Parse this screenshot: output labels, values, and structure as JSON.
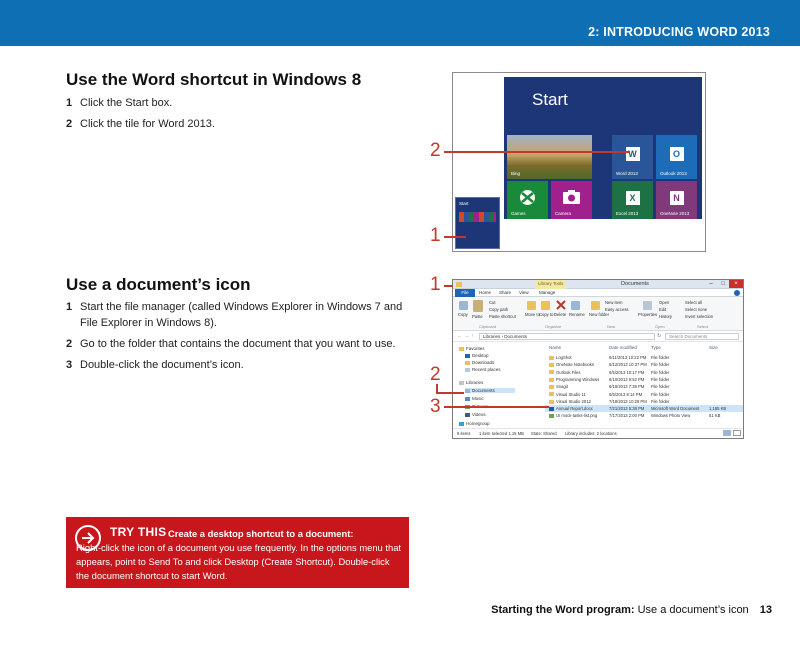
{
  "header": {
    "chapter": "2: INTRODUCING WORD 2013",
    "color": "#0e6fb5"
  },
  "section1": {
    "heading": "Use the Word shortcut in Windows 8",
    "steps": [
      {
        "num": "1",
        "text": "Click the Start box."
      },
      {
        "num": "2",
        "text": "Click the tile for Word 2013."
      }
    ]
  },
  "figure1": {
    "start_title": "Start",
    "callouts": [
      "2",
      "1"
    ],
    "tiles": [
      {
        "label": "Word 2013",
        "glyph": "W",
        "color": "#2a5699"
      },
      {
        "label": "Outlook 2013",
        "glyph": "O",
        "color": "#1e6bb8"
      },
      {
        "label": "Games",
        "glyph": "",
        "color": "#188a3a"
      },
      {
        "label": "Camera",
        "glyph": "",
        "color": "#a0208c"
      },
      {
        "label": "Excel 2013",
        "glyph": "X",
        "color": "#1e7145"
      },
      {
        "label": "OneNote 2013",
        "glyph": "N",
        "color": "#80397b"
      }
    ],
    "photo_tile_label": "Bing",
    "thumb_label": "Start"
  },
  "section2": {
    "heading": "Use a document’s icon",
    "steps": [
      {
        "num": "1",
        "text": "Start the file manager (called Windows Explorer in Windows 7 and File Explorer in Windows 8)."
      },
      {
        "num": "2",
        "text": "Go to the folder that contains the document that you want to use."
      },
      {
        "num": "3",
        "text": "Double-click the document’s icon."
      }
    ]
  },
  "figure2": {
    "callouts": [
      "1",
      "2",
      "3"
    ],
    "window_title": "Documents",
    "library_tools": "Library Tools",
    "tabs": {
      "file": "File",
      "home": "Home",
      "share": "Share",
      "view": "View",
      "manage": "Manage"
    },
    "ribbon": {
      "copy": "Copy",
      "paste": "Paste",
      "cut": "Cut",
      "copy_path": "Copy path",
      "paste_shortcut": "Paste shortcut",
      "move_to": "Move to",
      "copy_to": "Copy to",
      "delete": "Delete",
      "rename": "Rename",
      "new_folder": "New folder",
      "new_item": "New item",
      "easy_access": "Easy access",
      "properties": "Properties",
      "open": "Open",
      "edit": "Edit",
      "history": "History",
      "select_all": "Select all",
      "select_none": "Select none",
      "invert": "Invert selection",
      "groups": {
        "clipboard": "Clipboard",
        "organize": "Organize",
        "new": "New",
        "open": "Open",
        "select": "Select"
      }
    },
    "address": "Libraries  ›  Documents",
    "search_placeholder": "Search Documents",
    "nav": [
      {
        "label": "Favorites"
      },
      {
        "label": "Desktop"
      },
      {
        "label": "Downloads"
      },
      {
        "label": "Recent places"
      },
      {
        "label": "Libraries"
      },
      {
        "label": "Documents"
      },
      {
        "label": "Music"
      },
      {
        "label": "Pictures"
      },
      {
        "label": "Videos"
      },
      {
        "label": "Homegroup"
      }
    ],
    "columns": {
      "name": "Name",
      "date": "Date modified",
      "type": "Type",
      "size": "Size"
    },
    "rows": [
      {
        "name": "LogShot",
        "date": "6/11/2013 10:22 PM",
        "type": "File folder",
        "size": ""
      },
      {
        "name": "OneNote Notebooks",
        "date": "6/12/2013 10:37 PM",
        "type": "File folder",
        "size": ""
      },
      {
        "name": "Outlook Files",
        "date": "6/5/2013 10:17 PM",
        "type": "File folder",
        "size": ""
      },
      {
        "name": "Programming Windows",
        "date": "6/10/2013 9:52 PM",
        "type": "File folder",
        "size": ""
      },
      {
        "name": "Snagit",
        "date": "6/18/2013 7:36 PM",
        "type": "File folder",
        "size": ""
      },
      {
        "name": "Visual Studio 11",
        "date": "6/5/2013 8:14 PM",
        "type": "File folder",
        "size": ""
      },
      {
        "name": "Visual Studio 2012",
        "date": "7/18/2013 10:28 PM",
        "type": "File folder",
        "size": ""
      },
      {
        "name": "Annual Report.docx",
        "date": "7/21/2013 5:38 PM",
        "type": "Microsoft Word Document",
        "size": "1,185 KB"
      },
      {
        "name": "UI mock-tasks-list.png",
        "date": "7/17/2013 2:00 PM",
        "type": "Windows Photo View",
        "size": "51 KB"
      }
    ],
    "status": {
      "count": "9 items",
      "selected": "1 item selected  1.15 MB",
      "state": "State: Shared",
      "libs": "Library includes: 2 locations"
    }
  },
  "try_this": {
    "label": "TRY THIS",
    "lead": "Create a desktop shortcut to a document:",
    "body": "Right-click the icon of a document you use frequently. In the options menu that appears, point to Send To and click Desktop (Create Shortcut). Double-click the document shortcut to start Word.",
    "color": "#c8161d"
  },
  "footer": {
    "section": "Starting the Word program:",
    "topic": "Use a document’s icon",
    "page": "13"
  }
}
